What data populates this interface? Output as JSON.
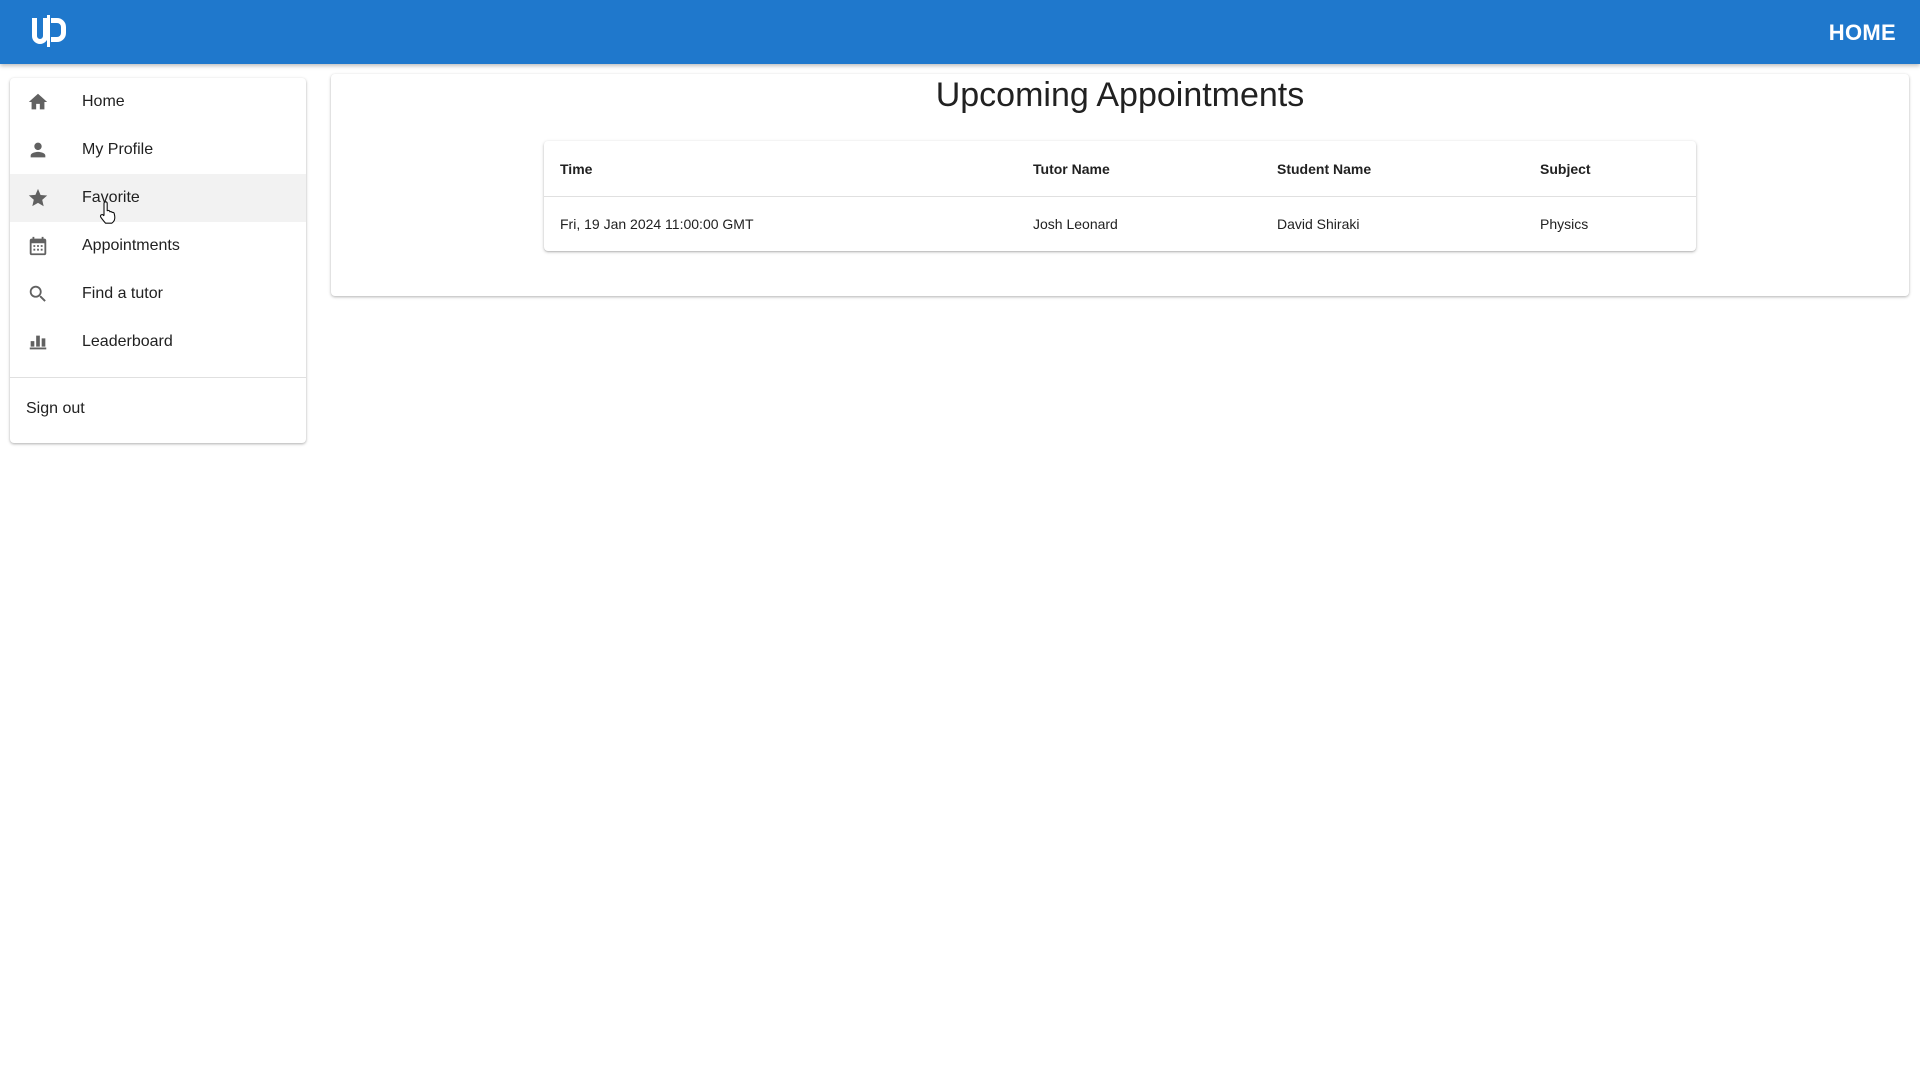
{
  "appbar": {
    "logo_icon": "utd-logo",
    "title": "HOME",
    "color": "#1f78cc"
  },
  "sidebar": {
    "items": [
      {
        "label": "Home",
        "icon": "home-icon"
      },
      {
        "label": "My Profile",
        "icon": "person-icon"
      },
      {
        "label": "Favorite",
        "icon": "star-icon"
      },
      {
        "label": "Appointments",
        "icon": "calendar-icon"
      },
      {
        "label": "Find a tutor",
        "icon": "search-icon"
      },
      {
        "label": "Leaderboard",
        "icon": "bar-chart-icon"
      }
    ],
    "signout_label": "Sign out"
  },
  "main": {
    "title": "Upcoming Appointments",
    "table": {
      "headers": [
        "Time",
        "Tutor Name",
        "Student Name",
        "Subject"
      ],
      "rows": [
        [
          "Fri, 19 Jan 2024 11:00:00 GMT",
          "Josh Leonard",
          "David Shiraki",
          "Physics"
        ]
      ]
    }
  }
}
